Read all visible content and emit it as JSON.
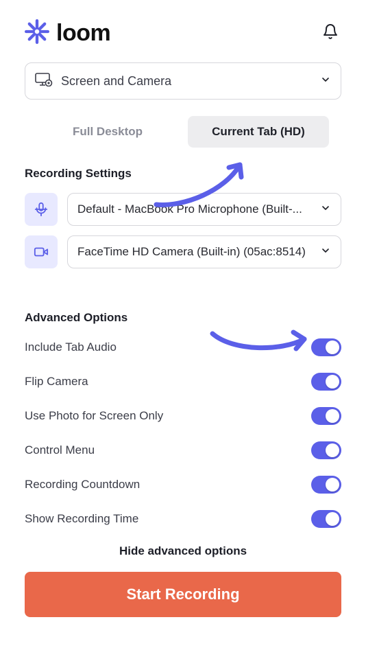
{
  "brand": {
    "name": "loom"
  },
  "mode_select": {
    "label": "Screen and Camera"
  },
  "tabs": [
    {
      "label": "Full Desktop",
      "active": false
    },
    {
      "label": "Current Tab (HD)",
      "active": true
    }
  ],
  "recording_settings": {
    "title": "Recording Settings",
    "microphone": "Default - MacBook Pro Microphone (Built-...",
    "camera": "FaceTime HD Camera (Built-in) (05ac:8514)"
  },
  "advanced": {
    "title": "Advanced Options",
    "options": [
      {
        "label": "Include Tab Audio",
        "on": true
      },
      {
        "label": "Flip Camera",
        "on": true
      },
      {
        "label": "Use Photo for Screen Only",
        "on": true
      },
      {
        "label": "Control Menu",
        "on": true
      },
      {
        "label": "Recording Countdown",
        "on": true
      },
      {
        "label": "Show Recording Time",
        "on": true
      }
    ]
  },
  "hide_advanced_label": "Hide advanced options",
  "start_label": "Start Recording",
  "colors": {
    "accent": "#5b5fe8",
    "primary_action": "#e9684a"
  }
}
